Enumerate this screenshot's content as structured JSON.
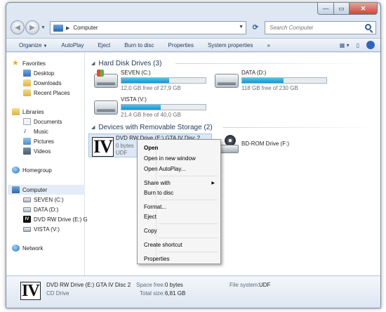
{
  "window": {
    "controls": {
      "minimize": "—",
      "maximize": "▭",
      "close": "✕"
    }
  },
  "address": {
    "breadcrumb": "Computer",
    "refresh_icon": "refresh-icon"
  },
  "search": {
    "placeholder": "Search Computer"
  },
  "toolbar": {
    "organize": "Organize",
    "autoplay": "AutoPlay",
    "eject": "Eject",
    "burn": "Burn to disc",
    "properties": "Properties",
    "system_properties": "System properties",
    "more": "»"
  },
  "nav": {
    "favorites": "Favorites",
    "desktop": "Desktop",
    "downloads": "Downloads",
    "recent": "Recent Places",
    "libraries": "Libraries",
    "documents": "Documents",
    "music": "Music",
    "pictures": "Pictures",
    "videos": "Videos",
    "homegroup": "Homegroup",
    "computer": "Computer",
    "seven": "SEVEN (C:)",
    "data": "DATA (D:)",
    "dvd": "DVD RW Drive (E:) G",
    "vista": "VISTA (V:)",
    "network": "Network"
  },
  "groups": {
    "hdd": "Hard Disk Drives (3)",
    "removable": "Devices with Removable Storage (2)"
  },
  "drives": [
    {
      "name": "SEVEN (C:)",
      "free": "12,0 GB free of 27,9 GB",
      "used_fraction": 0.57
    },
    {
      "name": "DATA (D:)",
      "free": "118 GB free of 230 GB",
      "used_fraction": 0.49
    },
    {
      "name": "VISTA (V:)",
      "free": "21,4 GB free of 40,0 GB",
      "used_fraction": 0.47
    }
  ],
  "removable": {
    "dvd_name": "DVD RW Drive (E:) GTA IV Disc 2",
    "dvd_line2": "0 bytes",
    "dvd_line3": "UDF",
    "logo": "IV",
    "bd_name": "BD-ROM Drive (F:)",
    "bd_badge": "BD"
  },
  "context_menu": {
    "open": "Open",
    "open_new_window": "Open in new window",
    "open_autoplay": "Open AutoPlay...",
    "share_with": "Share with",
    "burn": "Burn to disc",
    "format": "Format...",
    "eject": "Eject",
    "copy": "Copy",
    "create_shortcut": "Create shortcut",
    "properties": "Properties"
  },
  "status": {
    "logo": "IV",
    "name": "DVD RW Drive (E:) GTA IV Disc 2",
    "type": "CD Drive",
    "space_free_label": "Space free:",
    "space_free": "0 bytes",
    "total_size_label": "Total size:",
    "total_size": "6,81 GB",
    "fs_label": "File system:",
    "fs": "UDF"
  }
}
